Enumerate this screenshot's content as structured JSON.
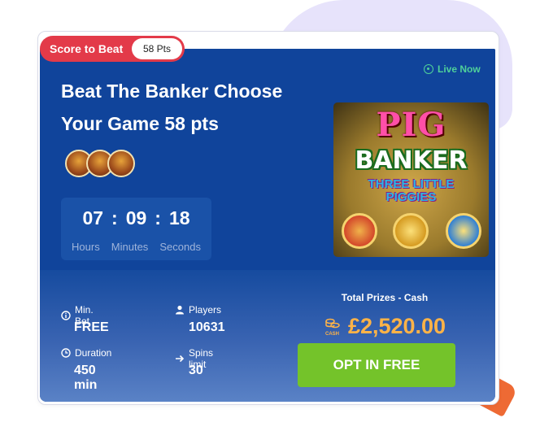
{
  "badge": {
    "label": "Score to Beat",
    "value": "58 Pts"
  },
  "live": {
    "label": "Live Now",
    "color": "#4fd19a"
  },
  "tournament": {
    "title": "Beat The Banker Choose Your Game 58 pts"
  },
  "timer": {
    "hours": "07",
    "minutes": "09",
    "seconds": "18",
    "separator": ":",
    "hours_label": "Hours",
    "minutes_label": "Minutes",
    "seconds_label": "Seconds"
  },
  "game_image": {
    "line1": "PIG",
    "line2": "BANKER",
    "line3": "THREE LITTLE",
    "line4": "PIGGIES"
  },
  "stats": {
    "min_bet": {
      "label": "Min. Bet",
      "value": "FREE",
      "icon": "info-icon"
    },
    "players": {
      "label": "Players",
      "value": "10631",
      "icon": "user-icon"
    },
    "duration": {
      "label": "Duration",
      "value": "450 min",
      "icon": "clock-icon"
    },
    "spins_limit": {
      "label": "Spins limit",
      "value": "30",
      "icon": "arrow-right-icon"
    }
  },
  "prizes": {
    "title": "Total Prizes - Cash",
    "amount": "£2,520.00",
    "cash_label": "CASH",
    "icon": "cash-coins-icon"
  },
  "cta": {
    "label": "OPT IN FREE",
    "color": "#74c32a"
  },
  "colors": {
    "card": "#10449b",
    "badge": "#e33a49",
    "prize": "#ffb347"
  }
}
